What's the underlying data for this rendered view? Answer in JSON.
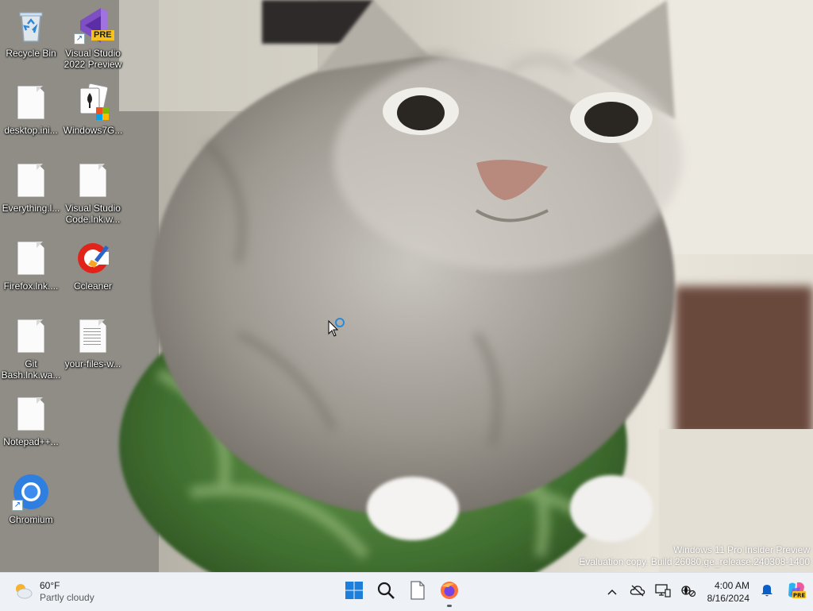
{
  "desktop": {
    "icons": [
      {
        "label": "Recycle Bin",
        "icon": "recycle-bin-icon"
      },
      {
        "label": "Visual Studio 2022 Preview",
        "icon": "visual-studio-icon",
        "badge": "PRE"
      },
      {
        "label": "desktop.ini...",
        "icon": "file-icon"
      },
      {
        "label": "Windows7G...",
        "icon": "solitaire-icon"
      },
      {
        "label": "Everything.l...",
        "icon": "file-icon"
      },
      {
        "label": "Visual Studio Code.lnk.w...",
        "icon": "file-icon"
      },
      {
        "label": "Firefox.lnk....",
        "icon": "file-icon"
      },
      {
        "label": "Ccleaner",
        "icon": "ccleaner-icon"
      },
      {
        "label": "Git Bash.lnk.wa...",
        "icon": "file-icon"
      },
      {
        "label": "your-files-w...",
        "icon": "text-file-icon"
      },
      {
        "label": "Notepad++...",
        "icon": "file-icon"
      },
      {
        "label": "Chromium",
        "icon": "chromium-icon"
      }
    ]
  },
  "watermark": {
    "line1": "Windows 11 Pro Insider Preview",
    "line2": "Evaluation copy. Build 26080.ge_release.240308-1400"
  },
  "taskbar": {
    "weather": {
      "temp": "60°F",
      "condition": "Partly cloudy",
      "icon": "partly-cloudy-icon"
    },
    "pinned": [
      {
        "name": "Start",
        "icon": "windows-start-icon"
      },
      {
        "name": "Search",
        "icon": "search-icon"
      },
      {
        "name": "File",
        "icon": "file-icon"
      },
      {
        "name": "Firefox",
        "icon": "firefox-icon",
        "active": true
      }
    ],
    "tray": [
      "chevron-up-icon",
      "cloud-offline-icon",
      "display-icon",
      "network-icon"
    ],
    "clock": {
      "time": "4:00 AM",
      "date": "8/16/2024"
    },
    "accent": "#0078d4"
  }
}
